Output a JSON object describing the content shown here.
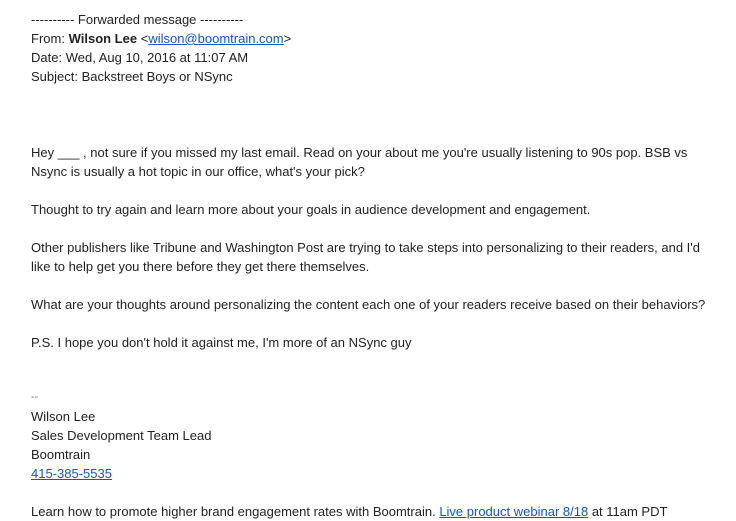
{
  "forward_header": {
    "separator": "---------- Forwarded message ----------",
    "from_label": "From:",
    "from_name": "Wilson Lee",
    "from_email_open": "<",
    "from_email": "wilson@boomtrain.com",
    "from_email_close": ">",
    "date_label": "Date:",
    "date_value": "Wed, Aug 10, 2016 at 11:07 AM",
    "subject_label": "Subject:",
    "subject_value": "Backstreet Boys or NSync"
  },
  "body": {
    "paragraphs": [
      "Hey ___ , not sure if you missed my last email. Read on your about me you're usually listening to 90s pop. BSB vs Nsync is usually a hot topic in our office, what's your pick?",
      "Thought to try again and learn more about your goals in audience development and engagement.",
      "Other publishers like Tribune and Washington Post are trying to take steps into personalizing to their readers, and I'd like to help get you there before they get there themselves.",
      "What are your thoughts around personalizing the content each one of your readers receive based on their behaviors?",
      "P.S. I hope you don't hold it against me, I'm more of an NSync guy"
    ]
  },
  "signature": {
    "dash": "--",
    "name": "Wilson Lee",
    "title": "Sales Development Team Lead",
    "company": "Boomtrain",
    "phone": "415-385-5535"
  },
  "footer": {
    "text_before": "Learn how to promote higher brand engagement rates with Boomtrain.",
    "link_text": "Live product webinar 8/18",
    "text_after": "at 11am PDT"
  },
  "colors": {
    "text": "#222222",
    "link": "#1155cc"
  }
}
